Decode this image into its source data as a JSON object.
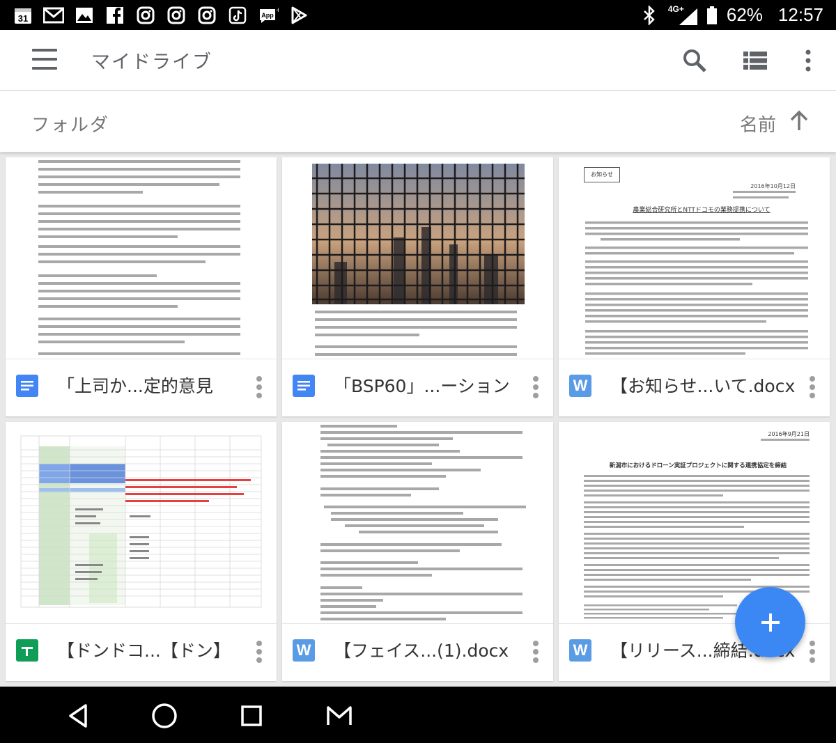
{
  "status_bar": {
    "date_icon_text": "31",
    "app_icon_text": "App",
    "network": "4G+",
    "battery": "62%",
    "time": "12:57"
  },
  "app_bar": {
    "title": "マイドライブ"
  },
  "sort_bar": {
    "section_label": "フォルダ",
    "sort_label": "名前"
  },
  "files": [
    {
      "name": "「上司か...定的意見",
      "type": "docs",
      "icon_color": "#4285f4"
    },
    {
      "name": "「BSP60」...ーション",
      "type": "docs",
      "icon_color": "#4285f4"
    },
    {
      "name": "【お知らせ...いて.docx",
      "type": "word",
      "icon_color": "#5a9be6",
      "icon_letter": "W"
    },
    {
      "name": "【ドンドコ...【ドン】",
      "type": "sheets",
      "icon_color": "#0f9d58"
    },
    {
      "name": "【フェイス...(1).docx",
      "type": "word",
      "icon_color": "#5a9be6",
      "icon_letter": "W"
    },
    {
      "name": "【リリース...締結.docx",
      "type": "word",
      "icon_color": "#5a9be6",
      "icon_letter": "W"
    }
  ],
  "thumb_text": {
    "card3_badge": "お知らせ",
    "card3_date": "2016年10月12日",
    "card3_heading": "農業総合研究所とNTTドコモの業務提携について",
    "card6_date": "2016年9月21日",
    "card6_heading": "新潟市におけるドローン実証プロジェクトに関する連携協定を締結"
  },
  "colors": {
    "accent": "#3b88f5",
    "docs": "#4285f4",
    "sheets": "#0f9d58",
    "word": "#5a9be6"
  }
}
